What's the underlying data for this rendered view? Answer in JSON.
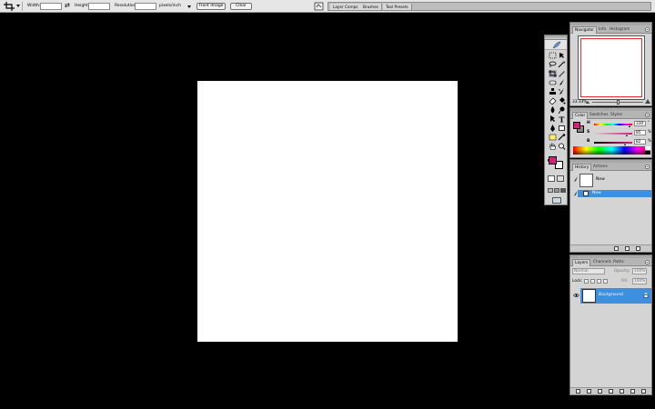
{
  "options_bar": {
    "width_label": "Width:",
    "height_label": "Height:",
    "resolution_label": "Resolution:",
    "unit_label": "pixels/inch",
    "front_image_label": "Front Image",
    "clear_label": "Clear"
  },
  "palette_well": {
    "tabs": [
      "Layer Comps",
      "Brushes",
      "Tool Presets"
    ]
  },
  "navigator_panel": {
    "tabs": [
      "Navigator",
      "Info",
      "Histogram"
    ],
    "zoom": "33.33%"
  },
  "color_panel": {
    "tabs": [
      "Color",
      "Swatches",
      "Styles"
    ],
    "foreground_color": "#d91d7d",
    "channels": [
      {
        "label": "H",
        "value": "330",
        "unit": "°"
      },
      {
        "label": "S",
        "value": "85",
        "unit": "%"
      },
      {
        "label": "B",
        "value": "82",
        "unit": "%"
      }
    ]
  },
  "history_panel": {
    "tabs": [
      "History",
      "Actions"
    ],
    "snapshot_label": "New",
    "state_label": "New"
  },
  "layers_panel": {
    "tabs": [
      "Layers",
      "Channels",
      "Paths"
    ],
    "blend_mode": "Normal",
    "opacity_label": "Opacity:",
    "opacity_value": "100%",
    "lock_label": "Lock:",
    "fill_label": "Fill:",
    "fill_value": "100%",
    "layer_name": "Background"
  },
  "colors": {
    "selection_blue": "#3d8fe0",
    "foreground_magenta": "#d91d7d",
    "navigator_proxy_red": "#e03030"
  }
}
